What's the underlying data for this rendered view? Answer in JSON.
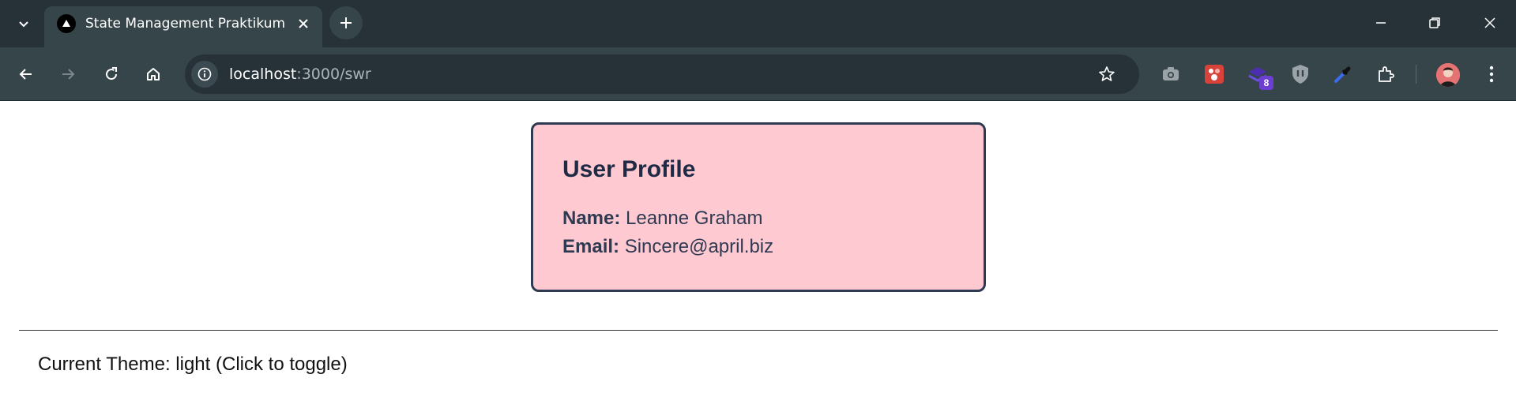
{
  "browser": {
    "tab": {
      "title": "State Management Praktikum"
    },
    "address_bar": {
      "host": "localhost",
      "rest": ":3000/swr"
    },
    "extensions": [
      {
        "icon": "camera-icon"
      },
      {
        "icon": "puzzle-red-icon"
      },
      {
        "icon": "stack-icon",
        "badge": "8"
      },
      {
        "icon": "shield-icon"
      },
      {
        "icon": "eyedropper-icon"
      },
      {
        "icon": "extensions-icon"
      }
    ]
  },
  "profile": {
    "title": "User Profile",
    "name_label": "Name:",
    "name_value": "Leanne Graham",
    "email_label": "Email:",
    "email_value": "Sincere@april.biz"
  },
  "theme": {
    "toggle_text": "Current Theme: light (Click to toggle)"
  },
  "colors": {
    "card_background": "#ffc9d2",
    "card_border": "#2e3a52",
    "chrome_dark": "#263238",
    "chrome_toolbar": "#36454a"
  }
}
